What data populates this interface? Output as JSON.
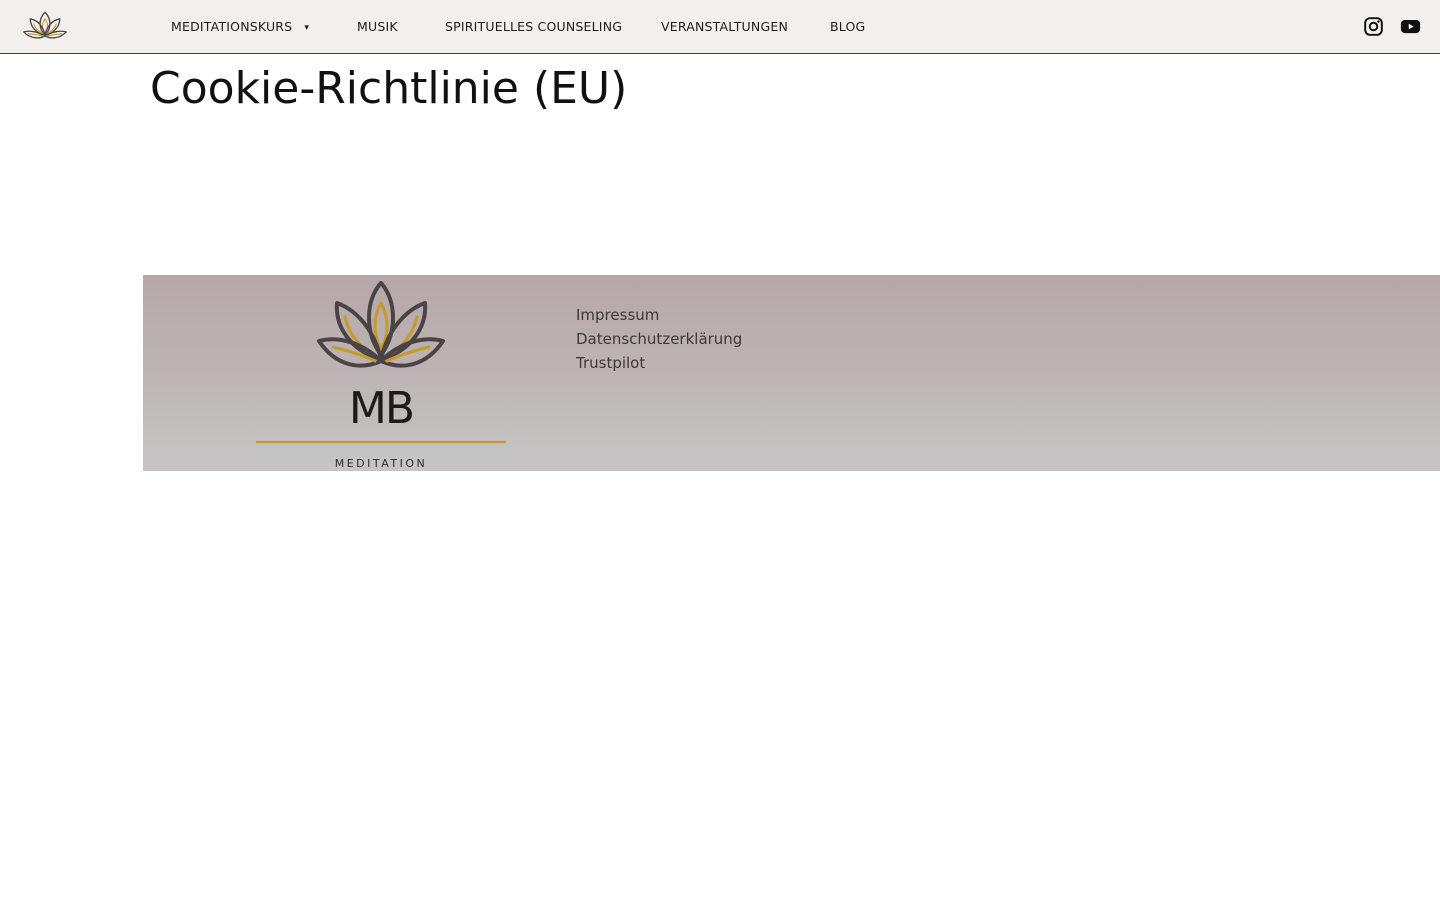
{
  "header": {
    "logo_icon": "lotus-logo-icon",
    "nav": [
      {
        "label": "MEDITATIONSKURS",
        "has_dropdown": true
      },
      {
        "label": "MUSIK"
      },
      {
        "label": "SPIRITUELLES COUNSELING"
      },
      {
        "label": "VERANSTALTUNGEN"
      },
      {
        "label": "BLOG"
      }
    ],
    "dropdown_icon": "▾",
    "social": [
      {
        "icon": "instagram-icon"
      },
      {
        "icon": "youtube-icon"
      }
    ]
  },
  "main": {
    "title": "Cookie-Richtlinie (EU)"
  },
  "footer": {
    "logo": {
      "monogram": "MB",
      "wordmark": "MEDITATION"
    },
    "links": [
      "Impressum",
      "Datenschutzerklärung",
      "Trustpilot"
    ]
  },
  "colors": {
    "header_bg": "#f2efec",
    "gold_accent": "#c79a2c",
    "logo_dark": "#4a4446"
  }
}
